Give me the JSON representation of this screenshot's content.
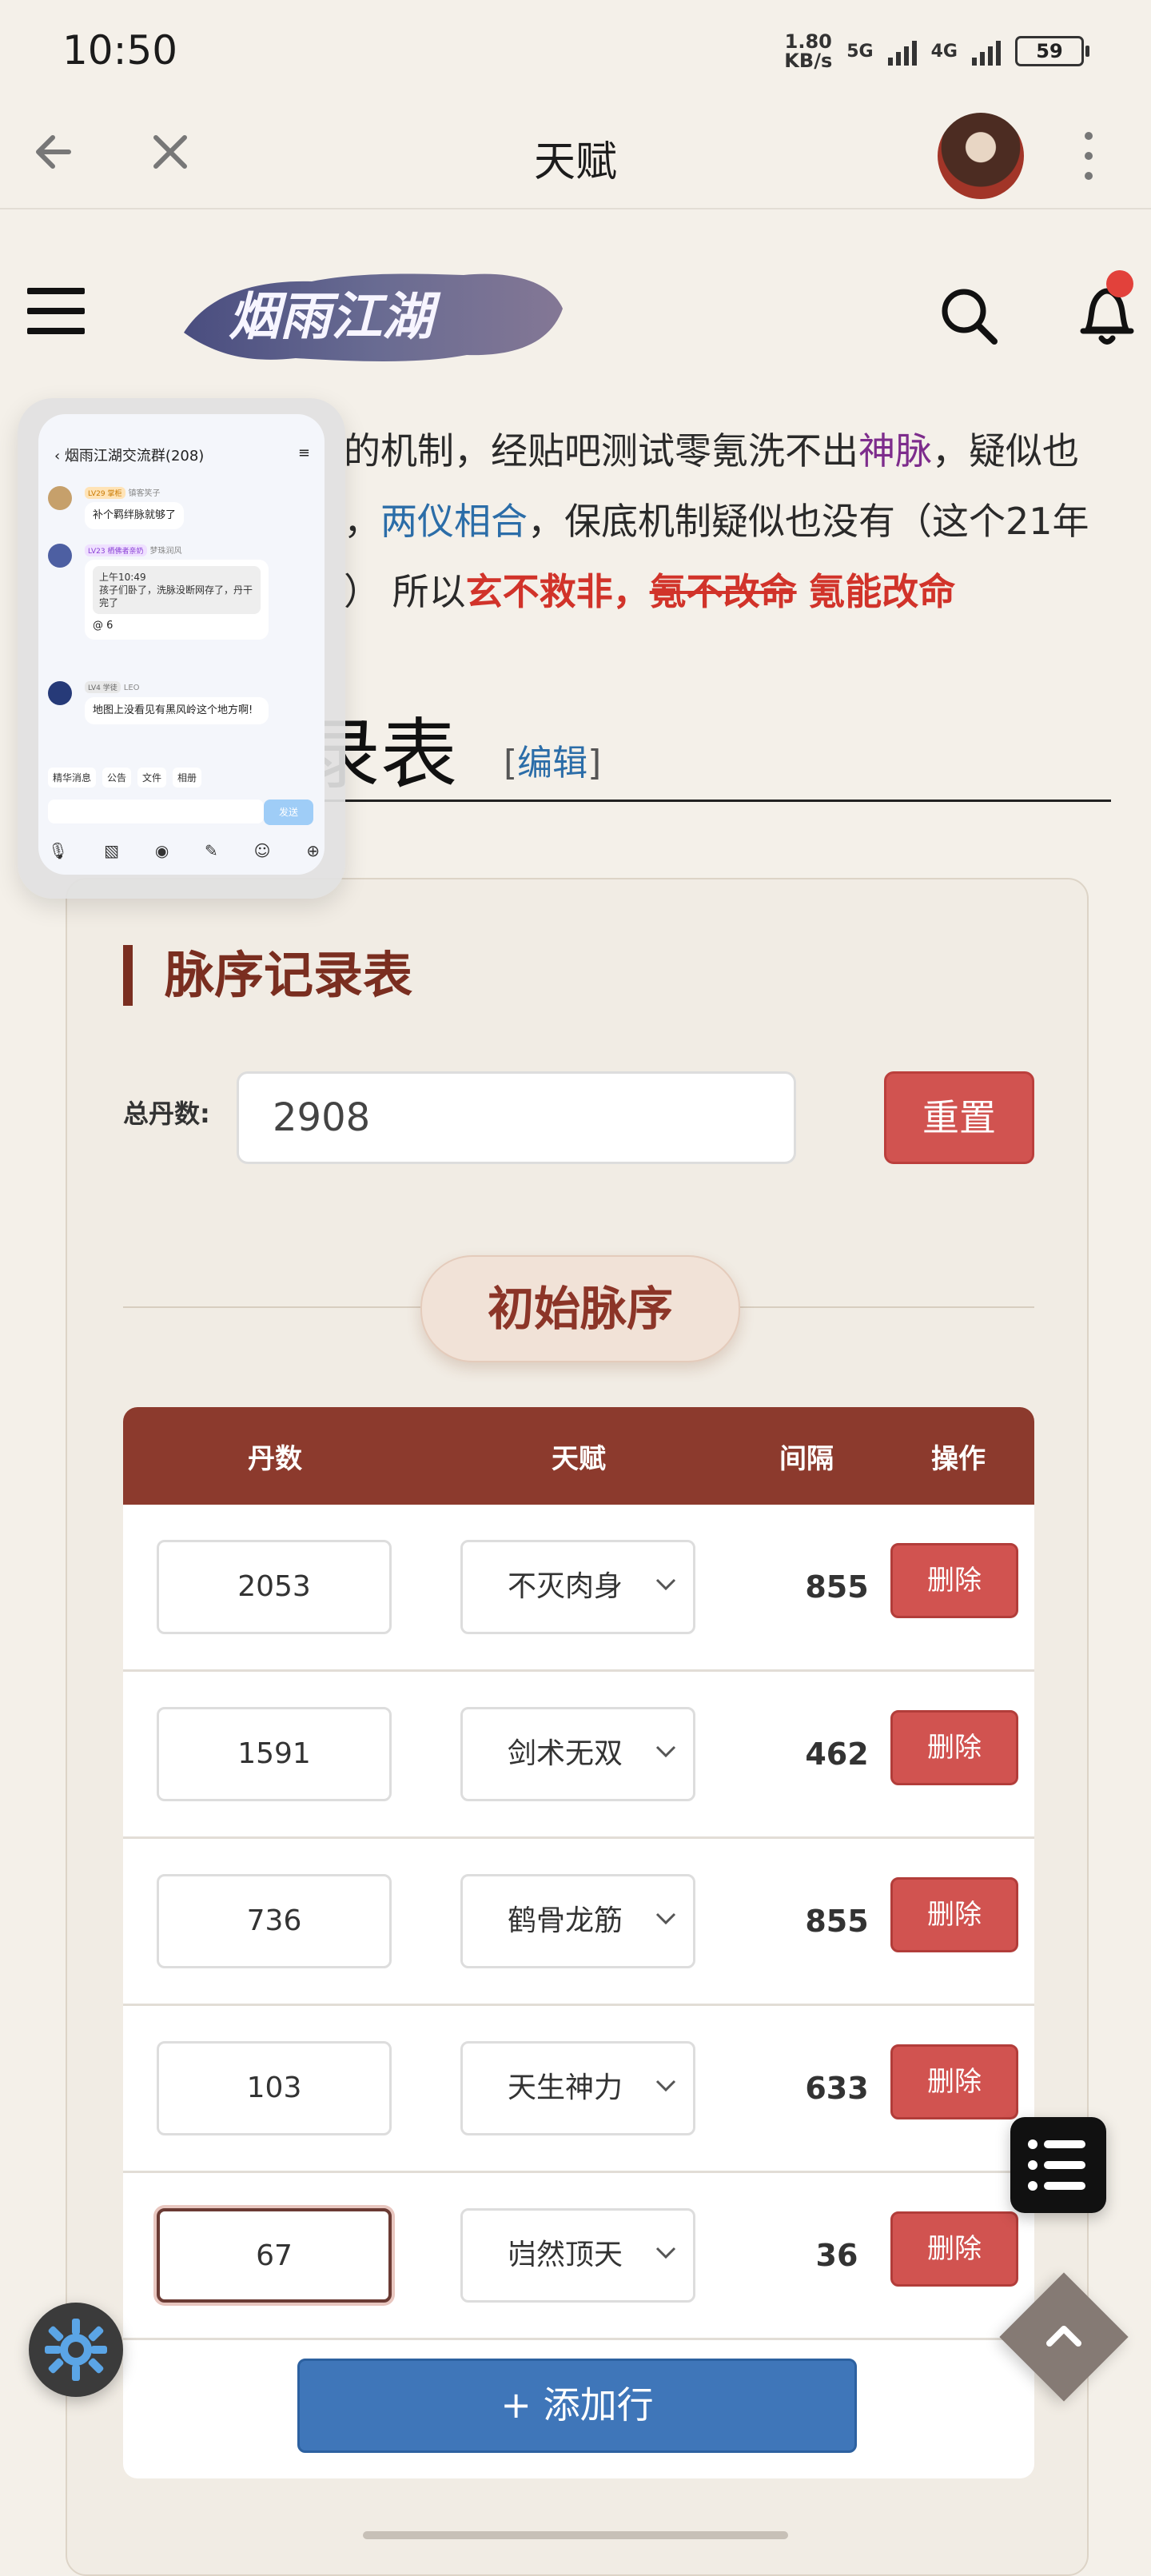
{
  "status": {
    "time": "10:50",
    "speed_value": "1.80",
    "speed_unit": "KB/s",
    "net1": "5G",
    "net2": "4G",
    "battery": "59"
  },
  "appbar": {
    "title": "天赋"
  },
  "header": {
    "logo_text": "烟雨江湖"
  },
  "article": {
    "line1_a": "的机制，经贴吧测试零氪洗不出",
    "line1_b": "神脉",
    "line1_c": "，疑似也",
    "line2_a": "，",
    "line2_b": "两仪相合",
    "line2_c": "，保底机制疑似也没有（这个21年",
    "line3_a": "）",
    "line3_b": "所以",
    "line3_c": "玄不救非，",
    "line3_d": "氪不改命",
    "line3_e": "氪能改命"
  },
  "section": {
    "title": "录表",
    "edit_open": "[",
    "edit": "编辑",
    "edit_close": "]"
  },
  "panel": {
    "title": "脉序记录表",
    "total_label": "总丹数:",
    "total_value": "2908",
    "reset": "重置",
    "initial_title": "初始脉序",
    "headers": {
      "dan": "丹数",
      "talent": "天赋",
      "interval": "间隔",
      "action": "操作"
    },
    "rows": [
      {
        "dan": "2053",
        "talent": "不灭肉身",
        "interval": "855",
        "delete": "删除"
      },
      {
        "dan": "1591",
        "talent": "剑术无双",
        "interval": "462",
        "delete": "删除"
      },
      {
        "dan": "736",
        "talent": "鹤骨龙筋",
        "interval": "855",
        "delete": "删除"
      },
      {
        "dan": "103",
        "talent": "天生神力",
        "interval": "633",
        "delete": "删除"
      },
      {
        "dan": "67",
        "talent": "岿然顶天",
        "interval": "36",
        "delete": "删除"
      }
    ],
    "add_row": "+ 添加行"
  },
  "floating_chat": {
    "title": "烟雨江湖交流群(208)",
    "msg1_badge": "LV29 掌柜",
    "msg1_name": "镇客笑子",
    "msg1_text": "补个羁绊脉就够了",
    "msg2_badge": "LV23 栖佛者亲奶",
    "msg2_name": "梦珠润风",
    "msg2_quote_time": "上午10:49",
    "msg2_quote_text": "孩子们卧了，洗脉没断网存了，丹干完了",
    "msg2_reply": "@ 6",
    "msg3_badge": "LV4 学徒",
    "msg3_name": "LEO",
    "msg3_text": "地图上没看见有黑风岭这个地方啊!",
    "quick": [
      "精华消息",
      "公告",
      "文件",
      "相册"
    ],
    "send": "发送"
  }
}
